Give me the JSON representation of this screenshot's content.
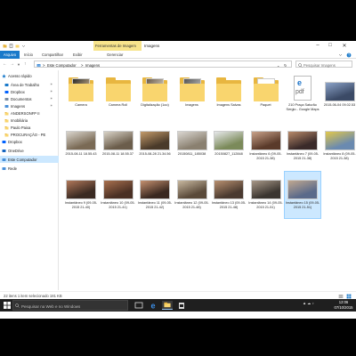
{
  "window": {
    "contextual_tab_group": "Ferramentas de Imagem",
    "title": "Imagens"
  },
  "ribbon": {
    "tabs": [
      "Arquivo",
      "Início",
      "Compartilhar",
      "Exibir",
      "Gerenciar"
    ]
  },
  "address": {
    "path": [
      "Este Computador",
      "Imagens"
    ],
    "search_placeholder": "Pesquisar Imagens"
  },
  "nav_pane": [
    {
      "label": "Acesso rápido",
      "icon": "star-icon",
      "pinned": false
    },
    {
      "label": "Área de Trabalho",
      "icon": "desktop-icon",
      "pinned": true
    },
    {
      "label": "Dropbox",
      "icon": "dropbox-icon",
      "pinned": true
    },
    {
      "label": "Documentos",
      "icon": "documents-icon",
      "pinned": true
    },
    {
      "label": "Imagens",
      "icon": "pictures-icon",
      "pinned": true
    },
    {
      "label": "ANDERSONFP II",
      "icon": "folder-icon",
      "pinned": false
    },
    {
      "label": "Imobiliária",
      "icon": "folder-icon",
      "pinned": false
    },
    {
      "label": "Paulo Paixa",
      "icon": "folder-icon",
      "pinned": false
    },
    {
      "label": "PROCURAÇÃO - PE",
      "icon": "folder-icon",
      "pinned": false
    },
    {
      "label": "Dropbox",
      "icon": "dropbox-icon",
      "pinned": false
    },
    {
      "label": "OneDrive",
      "icon": "onedrive-icon",
      "pinned": false
    },
    {
      "label": "Este Computador",
      "icon": "computer-icon",
      "pinned": false,
      "selected": true
    },
    {
      "label": "Rede",
      "icon": "network-icon",
      "pinned": false
    }
  ],
  "items": [
    {
      "label": "Camera",
      "kind": "folder-photos",
      "colors": [
        "#2a2a2a",
        "#c9b08a"
      ]
    },
    {
      "label": "Camera Roll",
      "kind": "folder",
      "colors": []
    },
    {
      "label": "Digitalização (1oo)",
      "kind": "folder-photos",
      "colors": [
        "#6a5a4a",
        "#d8d0c0"
      ]
    },
    {
      "label": "Imagens",
      "kind": "folder-photos",
      "colors": [
        "#555",
        "#bbb"
      ]
    },
    {
      "label": "Imagens Salvas",
      "kind": "folder",
      "colors": []
    },
    {
      "label": "Paquet",
      "kind": "folder-doc",
      "colors": []
    },
    {
      "label": "210 Praça Saturão Sergio - Google Maps",
      "kind": "pdf",
      "colors": []
    },
    {
      "label": "2015-06-04 09.02.53",
      "kind": "photo",
      "colors": [
        "#3b4a66",
        "#8ca3c8"
      ]
    },
    {
      "label": "2015-08-11 18.55.43",
      "kind": "photo",
      "colors": [
        "#7a6a55",
        "#d9d4cc"
      ]
    },
    {
      "label": "2015-08-11 18.55.37",
      "kind": "photo",
      "colors": [
        "#6b5d4b",
        "#d8d2c6"
      ]
    },
    {
      "label": "2015-08-28 21.34.56",
      "kind": "photo",
      "colors": [
        "#4a3a2a",
        "#c29a6a"
      ]
    },
    {
      "label": "20150811_185038",
      "kind": "photo",
      "colors": [
        "#8a8070",
        "#dad6d0"
      ]
    },
    {
      "label": "20150827_112848",
      "kind": "photo",
      "colors": [
        "#7b8a5a",
        "#e6e8ea"
      ]
    },
    {
      "label": "Instantâneo 6 (09-05-2015 21-38)",
      "kind": "photo",
      "colors": [
        "#5a3a2a",
        "#c9a28a"
      ]
    },
    {
      "label": "Instantâneo 7 (09-05-2015 21-38)",
      "kind": "photo",
      "colors": [
        "#3a2a2a",
        "#b88a6a"
      ]
    },
    {
      "label": "Instantâneo 8 (09-05-2015 21-38)",
      "kind": "photo",
      "colors": [
        "#6a8ab0",
        "#e2c84a"
      ]
    },
    {
      "label": "Instantâneo 9 (09-05-2015 21-40)",
      "kind": "photo",
      "colors": [
        "#3a2a22",
        "#b0785a"
      ]
    },
    {
      "label": "Instantâneo 10 (09-05-2015 21-41)",
      "kind": "photo",
      "colors": [
        "#4a3024",
        "#a8704e"
      ]
    },
    {
      "label": "Instantâneo 11 (09-05-2015 21-42)",
      "kind": "photo",
      "colors": [
        "#3a2820",
        "#c49070"
      ]
    },
    {
      "label": "Instantâneo 12 (09-05-2015 21-48)",
      "kind": "photo",
      "colors": [
        "#5a4a3a",
        "#c8b8a0"
      ]
    },
    {
      "label": "Instantâneo 13 (09-05-2015 21-48)",
      "kind": "photo",
      "colors": [
        "#4a3a30",
        "#b89070"
      ]
    },
    {
      "label": "Instantâneo 14 (09-05-2015 21-51)",
      "kind": "photo",
      "colors": [
        "#3a3530",
        "#a89888"
      ]
    },
    {
      "label": "Instantâneo 15 (09-05-2015 21-51)",
      "kind": "photo",
      "colors": [
        "#5a6a8a",
        "#c0a890"
      ],
      "selected": true
    }
  ],
  "status": {
    "text": "22 itens    1 item selecionado  181 KB"
  },
  "taskbar": {
    "search_placeholder": "Pesquisar na Web e no Windows",
    "time": "12:06",
    "date": "07/10/2015",
    "accent": "#9ac7f5"
  },
  "colors": {
    "file_tab": "#1979ca",
    "context_band": "#f7e48c",
    "selection": "#cce8ff",
    "folder": "#f9d56e"
  }
}
